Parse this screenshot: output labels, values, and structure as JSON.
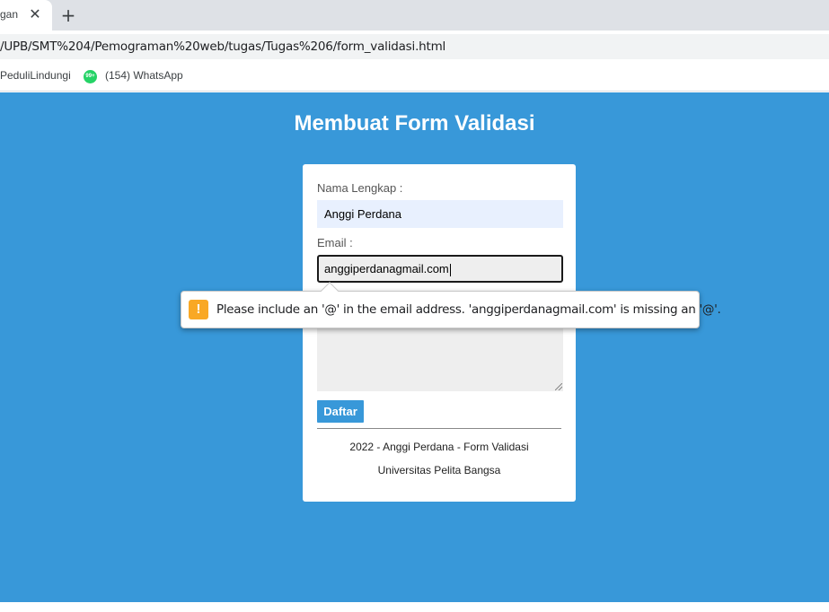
{
  "browser": {
    "tab_title": "gan",
    "tab_close": "✕",
    "new_tab": "+",
    "url": "/UPB/SMT%204/Pemograman%20web/tugas/Tugas%206/form_validasi.html",
    "bookmarks": [
      {
        "label": "PeduliLindungi"
      },
      {
        "label": "(154) WhatsApp",
        "icon_text": "99+"
      }
    ]
  },
  "page": {
    "title": "Membuat Form Validasi",
    "background_color": "#3898d9"
  },
  "form": {
    "name_label": "Nama Lengkap :",
    "name_value": "Anggi Perdana",
    "email_label": "Email :",
    "email_value": "anggiperdanagmail.com",
    "submit_label": "Daftar",
    "footer_line1": "2022 - Anggi Perdana - Form Validasi",
    "footer_line2": "Universitas Pelita Bangsa"
  },
  "validation": {
    "icon": "!",
    "message": "Please include an '@' in the email address. 'anggiperdanagmail.com' is missing an '@'."
  }
}
